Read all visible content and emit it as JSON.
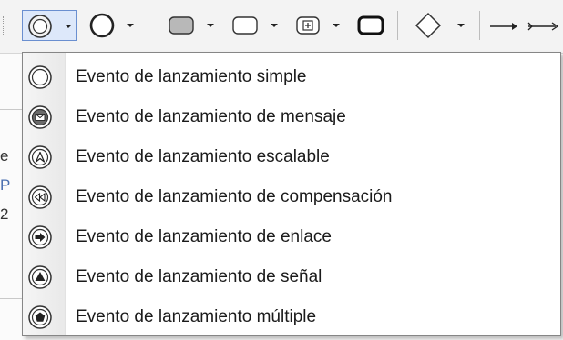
{
  "toolbar": {
    "buttons": [
      {
        "name": "start-event-shape-icon",
        "state": "pressed"
      },
      {
        "name": "end-event-shape-icon"
      },
      {
        "name": "task-shape-icon"
      },
      {
        "name": "subprocess-shape-icon"
      },
      {
        "name": "collapsed-subprocess-icon"
      },
      {
        "name": "call-activity-icon"
      },
      {
        "name": "gateway-shape-icon"
      },
      {
        "name": "sequence-flow-icon"
      },
      {
        "name": "message-flow-icon"
      }
    ]
  },
  "background": {
    "fragments": [
      "e",
      "P",
      "2"
    ]
  },
  "menu": {
    "items": [
      {
        "label": "Evento de lanzamiento simple",
        "icon": "start-event-none-icon"
      },
      {
        "label": "Evento de lanzamiento de mensaje",
        "icon": "start-event-message-icon"
      },
      {
        "label": "Evento de lanzamiento escalable",
        "icon": "start-event-escalation-icon"
      },
      {
        "label": "Evento de lanzamiento de compensación",
        "icon": "start-event-compensation-icon"
      },
      {
        "label": "Evento de lanzamiento de enlace",
        "icon": "start-event-link-icon"
      },
      {
        "label": "Evento de lanzamiento de señal",
        "icon": "start-event-signal-icon"
      },
      {
        "label": "Evento de lanzamiento múltiple",
        "icon": "start-event-multiple-icon"
      }
    ]
  }
}
